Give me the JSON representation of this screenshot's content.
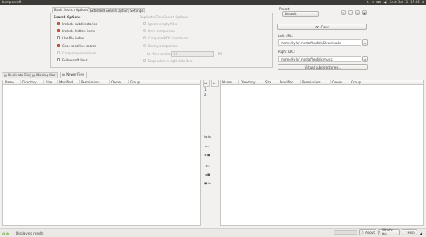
{
  "window": {
    "title": "bemposr.kft",
    "tray": [
      "⇅",
      "✉",
      "⌨",
      "◀)",
      "Sept Oct 11",
      "17:06",
      "⏻"
    ]
  },
  "tabs": {
    "basic": "Basic Search Options",
    "extended": "Extended Search Options",
    "settings": "Settings"
  },
  "search_options": {
    "heading": "Search Options",
    "items": [
      {
        "label": "Include subdirectories",
        "checked": true
      },
      {
        "label": "Include hidden items",
        "checked": true
      },
      {
        "label": "Use file index",
        "checked": false
      },
      {
        "label": "Case sensitive search",
        "checked": true
      },
      {
        "label": "Compare permissions",
        "checked": false,
        "disabled": true
      },
      {
        "label": "Follow soft links",
        "checked": false
      }
    ]
  },
  "duplicate_options": {
    "heading": "Duplicate Files Search Options",
    "items": [
      {
        "label": "Ignore empty files"
      },
      {
        "label": "Item comparison"
      },
      {
        "label": "Compare MD5 checksum"
      },
      {
        "label": "Binary comparison"
      }
    ],
    "for_files_smaller_than": "For files smaller than",
    "size_value": "50",
    "size_unit": "MB",
    "duplicates_right_side": "Duplicates in right side item"
  },
  "right_panel": {
    "preset_label": "Preset",
    "preset_value": "Default",
    "clear_label": "Clear",
    "left_url_label": "Left URL:",
    "left_url_value": "/home/kylo/.mediafile/disk/Downloads",
    "right_url_label": "Right URL:",
    "right_url_value": "/home/kylo/.mediafile/disk/music",
    "virtual_button": "Virtual subdirectories..."
  },
  "result_tabs": {
    "duplicate": "Duplicate Files",
    "missing": "Missing files",
    "newer": "Newer Files"
  },
  "columns_left": [
    "Name",
    "Directory",
    "Size",
    "Modified",
    "Permissions",
    "Owner",
    "Group"
  ],
  "columns_right": [
    "Name",
    "Directory",
    "Size",
    "Modified",
    "Permissions",
    "Owner",
    "Group"
  ],
  "gutter": {
    "header_left": "⊔",
    "header_right": "⊔",
    "row_a": "1",
    "row_b": "2"
  },
  "status": {
    "text": "Displaying results",
    "about": "About",
    "whats_this": "What's this",
    "help": "Help"
  }
}
